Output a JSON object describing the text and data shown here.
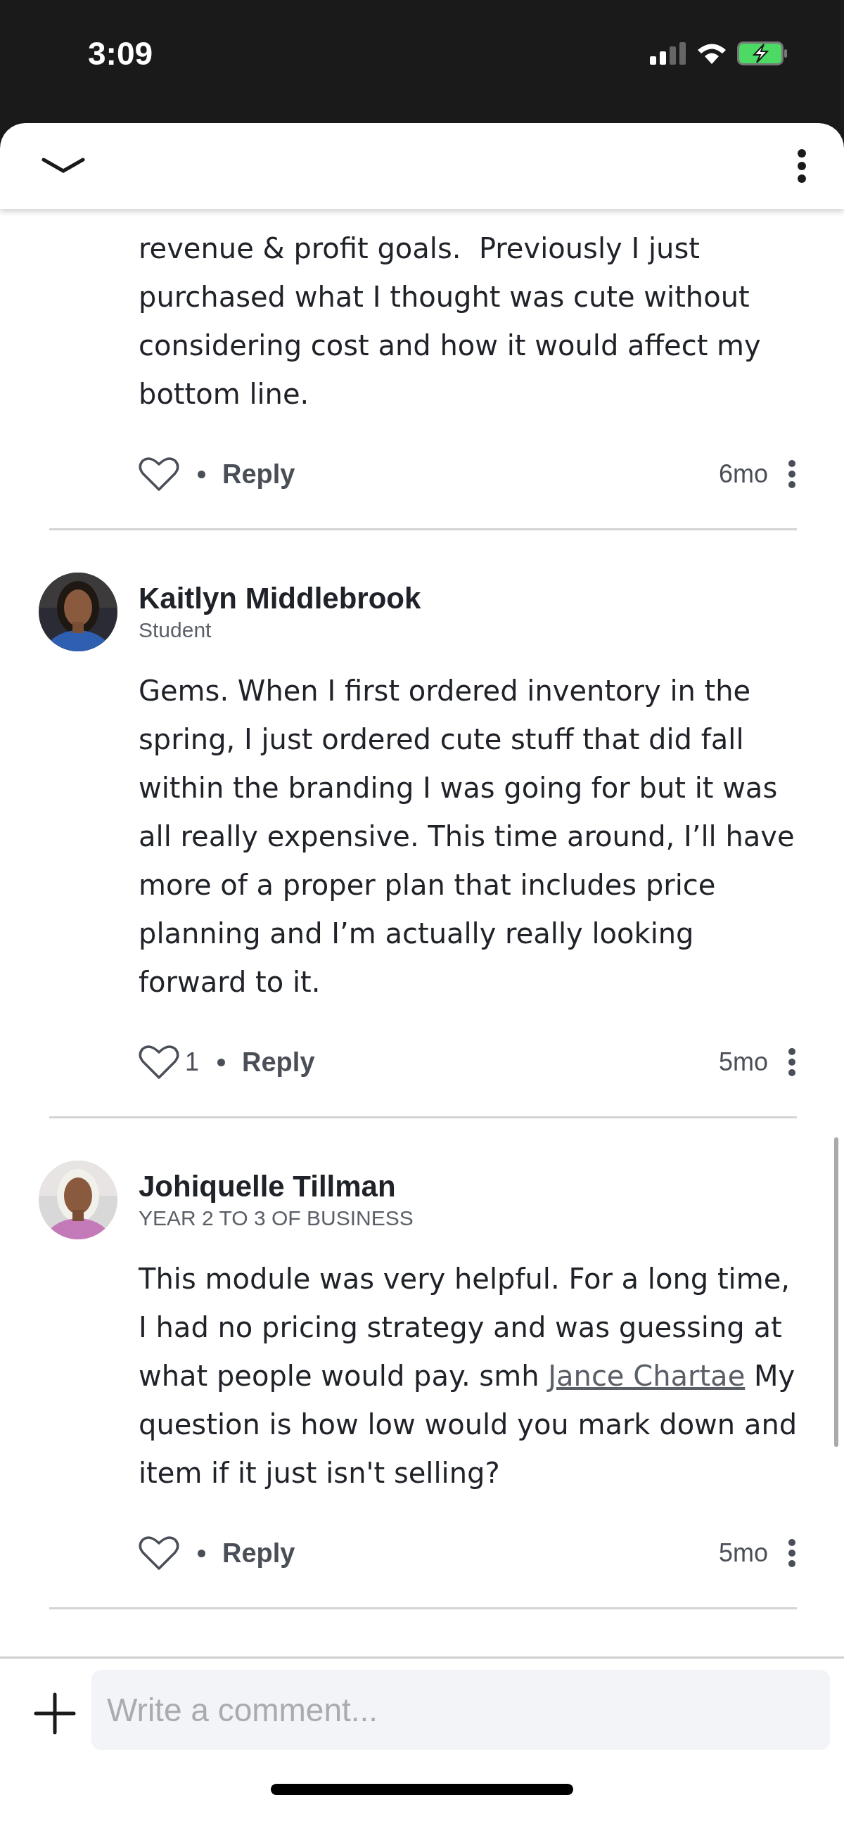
{
  "status_bar": {
    "time": "3:09"
  },
  "comments": [
    {
      "body": [
        {
          "kind": "text",
          "text": "revenue & profit goals.  Previously I just purchased what I thought was cute without considering cost and how it would affect my bottom line."
        }
      ],
      "reply": "Reply",
      "age": "6mo"
    },
    {
      "name": "Kaitlyn Middlebrook",
      "role": "Student",
      "body": [
        {
          "kind": "text",
          "text": "Gems. When I first ordered inventory in the spring, I just ordered cute stuff that did fall within the branding I was going for but it was all really expensive. This time around, I’ll have more of a proper plan that includes price planning and I’m actually really looking forward to it."
        }
      ],
      "likes": "1",
      "reply": "Reply",
      "age": "5mo"
    },
    {
      "name": "Johiquelle Tillman",
      "role": "YEAR 2 TO 3 OF BUSINESS",
      "body": [
        {
          "kind": "text",
          "text": "This module was very helpful. For a long time, I had no pricing strategy and was guessing at what people would pay. smh "
        },
        {
          "kind": "mention",
          "text": "Jance Chartae"
        },
        {
          "kind": "text",
          "text": " My question is how low would you mark down and item if it just isn't selling?"
        }
      ],
      "reply": "Reply",
      "age": "5mo"
    }
  ],
  "composer": {
    "placeholder": "Write a comment..."
  }
}
